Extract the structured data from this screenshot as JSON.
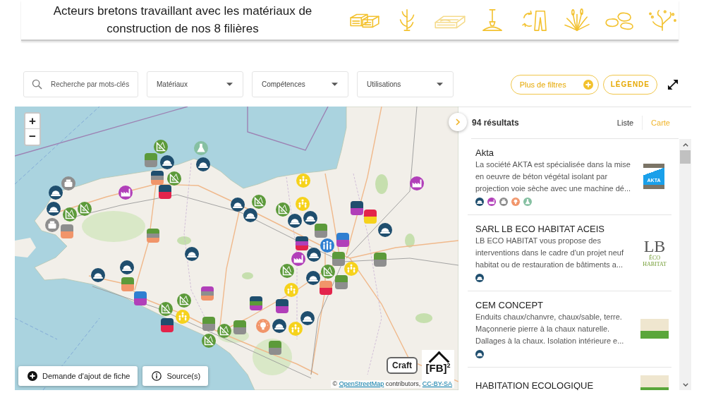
{
  "header": {
    "title": "Acteurs bretons travaillant avec les matériaux de construction de nos 8 filières"
  },
  "filters": {
    "search": {
      "placeholder": "Recherche par mots-clés"
    },
    "dropdowns": [
      {
        "label": "Matériaux"
      },
      {
        "label": "Compétences"
      },
      {
        "label": "Utilisations"
      }
    ],
    "more_filters": {
      "label": "Plus de filtres"
    },
    "legend": {
      "label": "LÉGENDE"
    }
  },
  "map": {
    "zoom": {
      "zoom_in": "+",
      "zoom_out": "−"
    },
    "markers": [
      {
        "kind": "stack",
        "stripes": [
          {
            "color": "#5c9a3a"
          },
          {
            "color": "#8e8e8e"
          }
        ]
      },
      {
        "kind": "setsquare",
        "color": "#5c9a3a"
      },
      {
        "kind": "flask",
        "color": "#86c0a2"
      },
      {
        "kind": "hardhat",
        "color": "#1f4e6e"
      },
      {
        "kind": "hardhat",
        "color": "#1f4e6e"
      },
      {
        "kind": "setsquare",
        "color": "#5c9a3a"
      },
      {
        "kind": "stack",
        "stripes": [
          {
            "color": "#1f4e6e"
          },
          {
            "color": "#8e8e8e"
          },
          {
            "color": "#f1956a"
          }
        ]
      },
      {
        "kind": "stack",
        "stripes": [
          {
            "color": "#1f4e6e"
          },
          {
            "color": "#e3244b"
          }
        ]
      },
      {
        "kind": "factory",
        "color": "#b13fb9"
      },
      {
        "kind": "machine",
        "color": "#8e8e8e"
      },
      {
        "kind": "hardhat",
        "color": "#1f4e6e"
      },
      {
        "kind": "setsquare",
        "color": "#5c9a3a"
      },
      {
        "kind": "hardhat",
        "color": "#1f4e6e"
      },
      {
        "kind": "setsquare",
        "color": "#5c9a3a"
      },
      {
        "kind": "stack",
        "stripes": [
          {
            "color": "#8e8e8e"
          },
          {
            "color": "#f1956a"
          }
        ]
      },
      {
        "kind": "machine",
        "color": "#8e8e8e"
      },
      {
        "kind": "stack",
        "stripes": [
          {
            "color": "#5c9a3a"
          },
          {
            "color": "#8e8e8e"
          },
          {
            "color": "#f1956a"
          }
        ]
      },
      {
        "kind": "hardhat",
        "color": "#1f4e6e"
      },
      {
        "kind": "hardhat",
        "color": "#1f4e6e"
      },
      {
        "kind": "hardhat",
        "color": "#1f4e6e"
      },
      {
        "kind": "stack",
        "stripes": [
          {
            "color": "#5c9a3a"
          },
          {
            "color": "#f1956a"
          }
        ]
      },
      {
        "kind": "stack",
        "stripes": [
          {
            "color": "#2f7fd1"
          },
          {
            "color": "#b13fb9"
          }
        ]
      },
      {
        "kind": "stack",
        "stripes": [
          {
            "color": "#b13fb9"
          },
          {
            "color": "#8e8e8e"
          },
          {
            "color": "#f1956a"
          }
        ]
      },
      {
        "kind": "setsquare",
        "color": "#5c9a3a"
      },
      {
        "kind": "people",
        "color": "#f6d21c"
      },
      {
        "kind": "setsquare",
        "color": "#5c9a3a"
      },
      {
        "kind": "stack",
        "stripes": [
          {
            "color": "#1f4e6e"
          },
          {
            "color": "#e3244b"
          }
        ]
      },
      {
        "kind": "stack",
        "stripes": [
          {
            "color": "#5c9a3a"
          },
          {
            "color": "#8e8e8e"
          }
        ]
      },
      {
        "kind": "setsquare",
        "color": "#5c9a3a"
      },
      {
        "kind": "setsquare",
        "color": "#5c9a3a"
      },
      {
        "kind": "stack",
        "stripes": [
          {
            "color": "#5c9a3a"
          },
          {
            "color": "#8e8e8e"
          }
        ]
      },
      {
        "kind": "stack",
        "stripes": [
          {
            "color": "#1f4e6e"
          },
          {
            "color": "#5c9a3a"
          },
          {
            "color": "#b13fb9"
          }
        ]
      },
      {
        "kind": "stack",
        "stripes": [
          {
            "color": "#1f4e6e"
          },
          {
            "color": "#b13fb9"
          }
        ]
      },
      {
        "kind": "bulb",
        "color": "#f1956a"
      },
      {
        "kind": "hardhat",
        "color": "#1f4e6e"
      },
      {
        "kind": "people",
        "color": "#f6d21c"
      },
      {
        "kind": "hardhat",
        "color": "#1f4e6e"
      },
      {
        "kind": "stack",
        "stripes": [
          {
            "color": "#5c9a3a"
          },
          {
            "color": "#8e8e8e"
          }
        ]
      },
      {
        "kind": "hardhat",
        "color": "#1f4e6e"
      },
      {
        "kind": "setsquare",
        "color": "#5c9a3a"
      },
      {
        "kind": "hardhat",
        "color": "#1f4e6e"
      },
      {
        "kind": "people",
        "color": "#f6d21c"
      },
      {
        "kind": "setsquare",
        "color": "#5c9a3a"
      },
      {
        "kind": "people",
        "color": "#f6d21c"
      },
      {
        "kind": "hardhat",
        "color": "#1f4e6e"
      },
      {
        "kind": "hardhat",
        "color": "#1f4e6e"
      },
      {
        "kind": "stack",
        "stripes": [
          {
            "color": "#5c9a3a"
          },
          {
            "color": "#8e8e8e"
          }
        ]
      },
      {
        "kind": "stack",
        "stripes": [
          {
            "color": "#2f7fd1"
          },
          {
            "color": "#b13fb9"
          }
        ]
      },
      {
        "kind": "group",
        "color": "#2f7fd1"
      },
      {
        "kind": "stack",
        "stripes": [
          {
            "color": "#1f4e6e"
          },
          {
            "color": "#b13fb9"
          },
          {
            "color": "#e3244b"
          }
        ]
      },
      {
        "kind": "hardhat",
        "color": "#1f4e6e"
      },
      {
        "kind": "factory",
        "color": "#b13fb9"
      },
      {
        "kind": "setsquare",
        "color": "#5c9a3a"
      },
      {
        "kind": "stack",
        "stripes": [
          {
            "color": "#5c9a3a"
          },
          {
            "color": "#8e8e8e"
          }
        ]
      },
      {
        "kind": "people",
        "color": "#f6d21c"
      },
      {
        "kind": "hardhat",
        "color": "#1f4e6e"
      },
      {
        "kind": "setsquare",
        "color": "#5c9a3a"
      },
      {
        "kind": "stack",
        "stripes": [
          {
            "color": "#5c9a3a"
          },
          {
            "color": "#8e8e8e"
          }
        ]
      },
      {
        "kind": "stack",
        "stripes": [
          {
            "color": "#f1956a"
          },
          {
            "color": "#e3244b"
          }
        ]
      },
      {
        "kind": "people",
        "color": "#f6d21c"
      },
      {
        "kind": "stack",
        "stripes": [
          {
            "color": "#1f4e6e"
          },
          {
            "color": "#b13fb9"
          }
        ]
      },
      {
        "kind": "stack",
        "stripes": [
          {
            "color": "#e3244b"
          },
          {
            "color": "#f6d21c"
          }
        ]
      },
      {
        "kind": "hardhat",
        "color": "#1f4e6e"
      },
      {
        "kind": "stack",
        "stripes": [
          {
            "color": "#5c9a3a"
          },
          {
            "color": "#8e8e8e"
          }
        ]
      },
      {
        "kind": "factory",
        "color": "#b13fb9"
      }
    ],
    "actions": [
      {
        "kind": "add",
        "label": "Demande d'ajout de fiche"
      },
      {
        "kind": "info",
        "label": "Source(s)"
      }
    ],
    "logos": [
      {
        "kind": "craft",
        "text": "Craft"
      },
      {
        "kind": "fb",
        "text": "[FB]$^{2}$"
      }
    ],
    "attribution": [
      {
        "kind": "text",
        "text": "©"
      },
      {
        "kind": "link",
        "text": "OpenStreetMap"
      },
      {
        "kind": "text",
        "text": "contributors,"
      },
      {
        "kind": "link",
        "text": "CC-BY-SA"
      }
    ]
  },
  "results": {
    "count": "94 résultats",
    "views": [
      {
        "label": "Liste",
        "selected": false
      },
      {
        "label": "Carte",
        "selected": true
      }
    ],
    "items": [
      {
        "title": "Akta",
        "description": "La société AKTA est spécialisée dans la mise en oeuvre de béton végétal isolant par projection voie sèche avec une machine dé...",
        "tags": [
          {
            "kind": "hardhat",
            "color": "#1f4e6e"
          },
          {
            "kind": "factory",
            "color": "#b13fb9"
          },
          {
            "kind": "machine",
            "color": "#8e8e8e"
          },
          {
            "kind": "bulb",
            "color": "#f1956a"
          },
          {
            "kind": "flask",
            "color": "#86c0a2"
          }
        ],
        "logo": {
          "kind": "akta",
          "text": "AKTA"
        }
      },
      {
        "title": "SARL LB ECO HABITAT ACEIS",
        "description": "LB ECO HABITAT vous propose des interventions dans le cadre d'un projet neuf habitat ou de restauration de bâtiments a...",
        "tags": [
          {
            "kind": "hardhat",
            "color": "#1f4e6e"
          }
        ],
        "logo": {
          "kind": "lb",
          "text": "LB",
          "subtext": "ÉCO HABITAT"
        }
      },
      {
        "title": "CEM CONCEPT",
        "description": "Enduits chaux/chanvre, chaux/sable, terre. Maçonnerie pierre à la chaux naturelle. Dallages à la chaux. Isolation intérieure e...",
        "tags": [
          {
            "kind": "hardhat",
            "color": "#1f4e6e"
          }
        ],
        "logo": {
          "kind": "image"
        }
      },
      {
        "title": "HABITATION ECOLOGIQUE",
        "logo": {
          "kind": "image"
        }
      }
    ]
  }
}
